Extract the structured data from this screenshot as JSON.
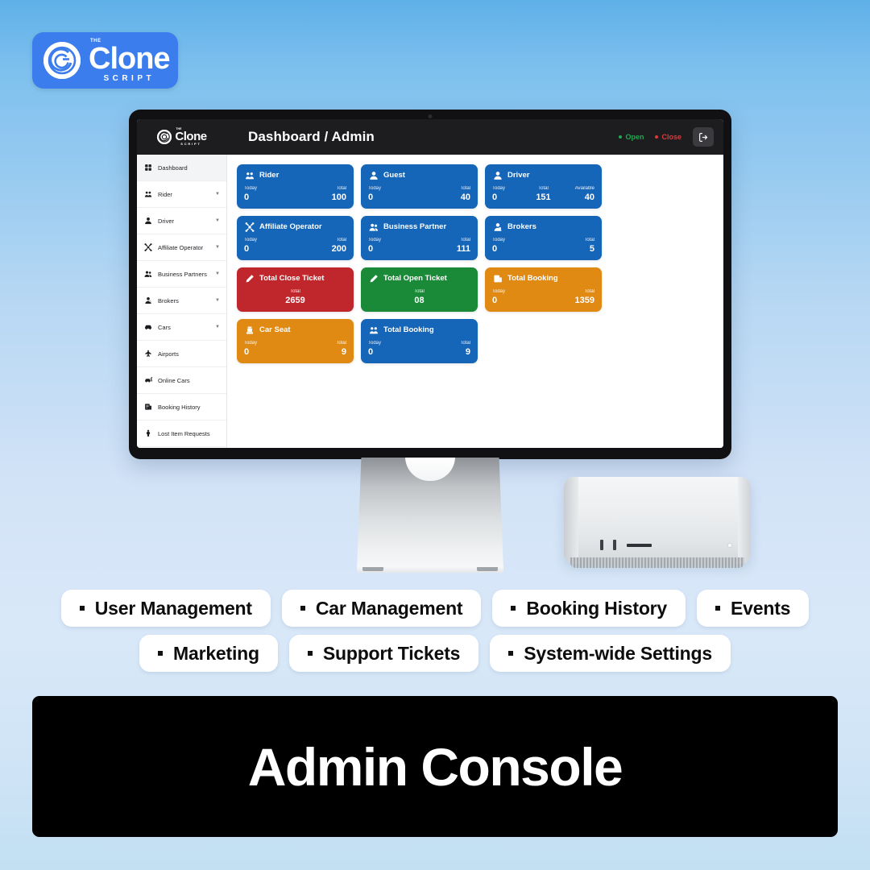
{
  "brand": {
    "the": "THE",
    "name": "Clone",
    "sub": "SCRIPT"
  },
  "app": {
    "header": {
      "title": "Dashboard / Admin",
      "status_open": "Open",
      "status_close": "Close",
      "logout_icon": "logout-icon"
    },
    "sidebar": {
      "items": [
        {
          "label": "Dashboard",
          "icon": "grid-icon",
          "caret": false,
          "active": true
        },
        {
          "label": "Rider",
          "icon": "riders-icon",
          "caret": true,
          "active": false
        },
        {
          "label": "Driver",
          "icon": "person-icon",
          "caret": true,
          "active": false
        },
        {
          "label": "Affiliate Operator",
          "icon": "network-icon",
          "caret": true,
          "active": false
        },
        {
          "label": "Business Partners",
          "icon": "people-icon",
          "caret": true,
          "active": false
        },
        {
          "label": "Brokers",
          "icon": "broker-icon",
          "caret": true,
          "active": false
        },
        {
          "label": "Cars",
          "icon": "car-icon",
          "caret": true,
          "active": false
        },
        {
          "label": "Airports",
          "icon": "airport-icon",
          "caret": false,
          "active": false
        },
        {
          "label": "Online Cars",
          "icon": "online-car-icon",
          "caret": false,
          "active": false
        },
        {
          "label": "Booking History",
          "icon": "booking-icon",
          "caret": false,
          "active": false
        },
        {
          "label": "Lost Item Requests",
          "icon": "lost-item-icon",
          "caret": false,
          "active": false
        }
      ]
    },
    "cards": [
      {
        "title": "Rider",
        "color": "blue",
        "accent": "#1565b8",
        "icon": "riders-icon",
        "stats": [
          {
            "label": "Today",
            "value": "0"
          },
          {
            "label": "Total",
            "value": "100"
          }
        ]
      },
      {
        "title": "Guest",
        "color": "blue",
        "accent": "#1565b8",
        "icon": "person-icon",
        "stats": [
          {
            "label": "Today",
            "value": "0"
          },
          {
            "label": "Total",
            "value": "40"
          }
        ]
      },
      {
        "title": "Driver",
        "color": "blue",
        "accent": "#1565b8",
        "icon": "person-icon",
        "stats": [
          {
            "label": "Today",
            "value": "0"
          },
          {
            "label": "Total",
            "value": "151"
          },
          {
            "label": "Available",
            "value": "40"
          }
        ]
      },
      {
        "title": "Affiliate Operator",
        "color": "blue",
        "accent": "#1565b8",
        "icon": "network-icon",
        "stats": [
          {
            "label": "Today",
            "value": "0"
          },
          {
            "label": "Total",
            "value": "200"
          }
        ]
      },
      {
        "title": "Business Partner",
        "color": "blue",
        "accent": "#1565b8",
        "icon": "people-icon",
        "stats": [
          {
            "label": "Today",
            "value": "0"
          },
          {
            "label": "Total",
            "value": "111"
          }
        ]
      },
      {
        "title": "Brokers",
        "color": "blue",
        "accent": "#1565b8",
        "icon": "broker-icon",
        "stats": [
          {
            "label": "Today",
            "value": "0"
          },
          {
            "label": "Total",
            "value": "5"
          }
        ]
      },
      {
        "title": "Total Close Ticket",
        "color": "red",
        "accent": "#c0272d",
        "icon": "pencil-icon",
        "stats": [
          {
            "label": "Total",
            "value": "2659"
          }
        ]
      },
      {
        "title": "Total Open Ticket",
        "color": "green",
        "accent": "#1a8a38",
        "icon": "pencil-icon",
        "stats": [
          {
            "label": "Total",
            "value": "08"
          }
        ]
      },
      {
        "title": "Total Booking",
        "color": "orange",
        "accent": "#e08a14",
        "icon": "booking-icon",
        "stats": [
          {
            "label": "Today",
            "value": "0"
          },
          {
            "label": "Total",
            "value": "1359"
          }
        ]
      },
      {
        "title": "Car Seat",
        "color": "orange",
        "accent": "#e08a14",
        "icon": "car-seat-icon",
        "stats": [
          {
            "label": "Today",
            "value": "0"
          },
          {
            "label": "Total",
            "value": "9"
          }
        ]
      },
      {
        "title": "Total Booking",
        "color": "blue",
        "accent": "#1565b8",
        "icon": "riders-icon",
        "stats": [
          {
            "label": "Today",
            "value": "0"
          },
          {
            "label": "Total",
            "value": "9"
          }
        ]
      }
    ]
  },
  "features": {
    "row1": [
      "User Management",
      "Car Management",
      "Booking History",
      "Events"
    ],
    "row2": [
      "Marketing",
      "Support Tickets",
      "System-wide Settings"
    ]
  },
  "banner": {
    "title": "Admin Console"
  }
}
